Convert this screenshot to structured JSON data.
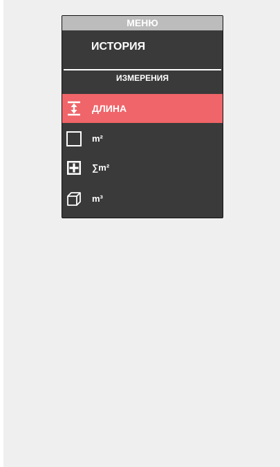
{
  "menu": {
    "title": "МЕНЮ",
    "history_label": "ИСТОРИЯ",
    "section_label": "ИЗМЕРЕНИЯ",
    "items": [
      {
        "label": "ДЛИНА",
        "icon": "length-measure-icon",
        "active": true
      },
      {
        "label": "m²",
        "icon": "square-area-icon",
        "active": false
      },
      {
        "label": "∑m²",
        "icon": "sum-area-icon",
        "active": false
      },
      {
        "label": "m³",
        "icon": "cube-volume-icon",
        "active": false
      }
    ]
  },
  "colors": {
    "background": "#efeff0",
    "menu_bg": "#3a3a3a",
    "header_bg": "#bcbcbc",
    "active_item": "#ef6569",
    "text": "#ffffff"
  }
}
